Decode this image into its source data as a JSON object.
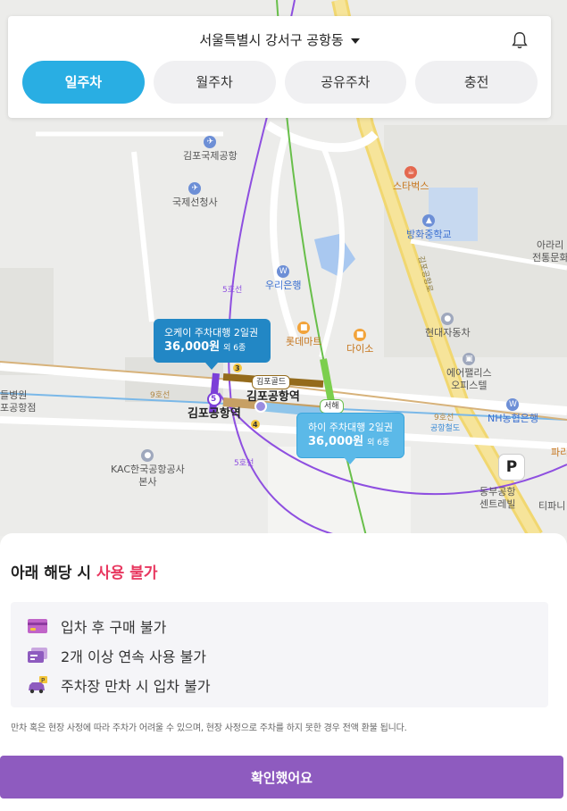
{
  "header": {
    "location": "서울특별시 강서구 공항동"
  },
  "tabs": [
    {
      "label": "일주차",
      "active": true
    },
    {
      "label": "월주차",
      "active": false
    },
    {
      "label": "공유주차",
      "active": false
    },
    {
      "label": "충전",
      "active": false
    }
  ],
  "map": {
    "labels": {
      "gimpo_airport": "김포국제공항",
      "crossing": "국제선청사",
      "starbucks": "스타벅스",
      "banghwa_school": "방화중학교",
      "woori_bank": "우리은행",
      "lotte_mart": "롯데마트",
      "daiso": "다이소",
      "hyundai": "현대자동차",
      "airpalace": "에어팰리스",
      "office": "오피스텔",
      "station_big": "김포공항역",
      "station": "김포공항역",
      "nh_bank": "NH농협은행",
      "kac": "KAC한국공항공사",
      "kac_hq": "본사",
      "dongbu": "동부공항",
      "central": "센트레빌",
      "hospital": "들병원",
      "hospital2": "포공항점",
      "arari": "아라리",
      "jeontong": "전통문화",
      "tiffany": "티파니",
      "pari": "파리",
      "line5": "5호선",
      "line5b": "5호선",
      "line9": "9호선",
      "line9b": "9호선",
      "airport_rail": "공항철도",
      "gimpo_gold": "김포골드",
      "seohae": "서해",
      "road": "김포공항로",
      "five": "5",
      "three": "3",
      "four": "4"
    },
    "cards": [
      {
        "name": "오케이 주차대행 2일권",
        "price": "36,000원",
        "extra": "외 6종",
        "color": "#2287c5"
      },
      {
        "name": "하이 주차대행 2일권",
        "price": "36,000원",
        "extra": "외 6종",
        "color": "#5bb9e8"
      }
    ],
    "parking_label": "P"
  },
  "sheet": {
    "title_prefix": "아래 해당 시",
    "title_warning": "사용 불가",
    "rules": [
      {
        "icon": "credit-card-icon",
        "text": "입차 후 구매 불가"
      },
      {
        "icon": "tickets-icon",
        "text": "2개 이상 연속 사용 불가"
      },
      {
        "icon": "car-parking-icon",
        "text": "주차장 만차 시 입차 불가"
      }
    ],
    "notice": "만차 혹은 현장 사정에 따라 주차가 어려울 수 있으며, 현장 사정으로 주차를 하지 못한 경우 전액 환불 됩니다.",
    "confirm_label": "확인했어요"
  },
  "colors": {
    "accent": "#29aee3",
    "warning": "#e8375f",
    "confirm": "#8e5bbf"
  }
}
